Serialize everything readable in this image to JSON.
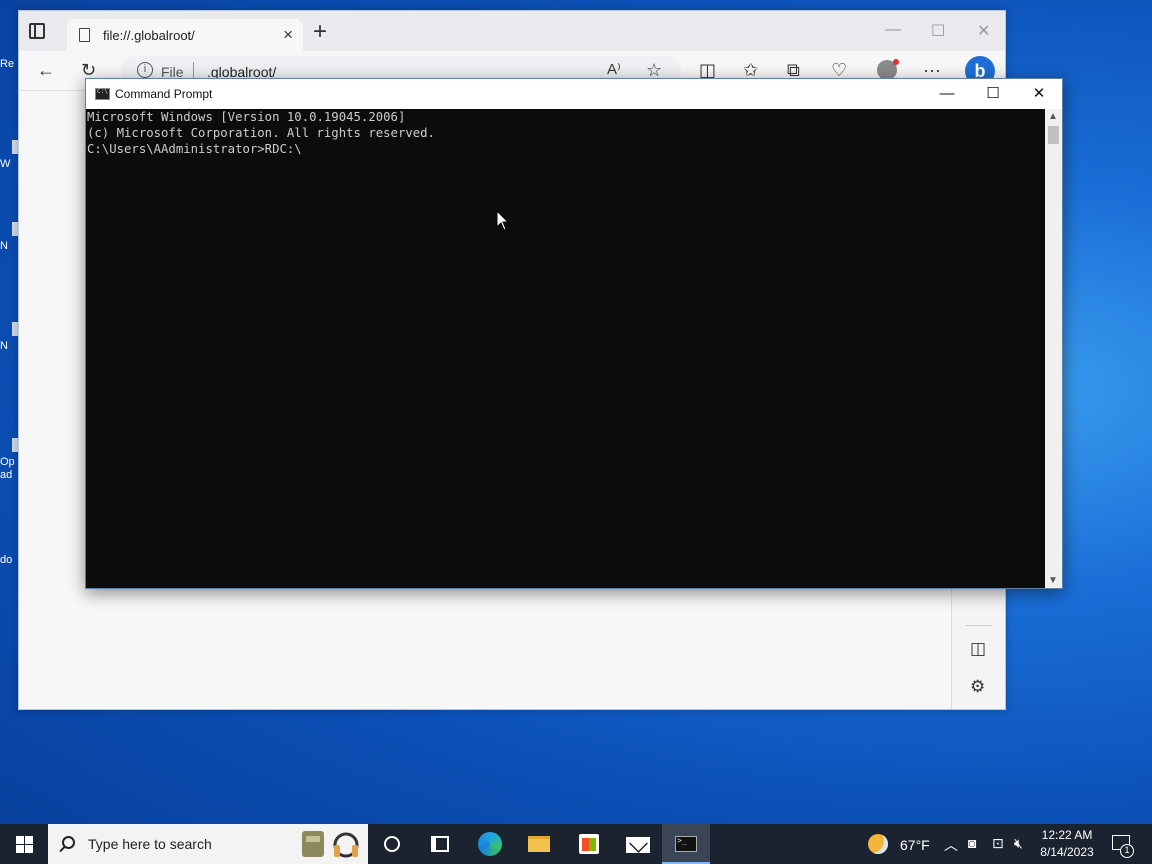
{
  "desktop": {
    "fragments": [
      "Re",
      "W",
      "N",
      "N",
      "Op",
      "ad",
      "do"
    ]
  },
  "browser": {
    "tab_title": "file://.globalroot/",
    "address_scheme": "File",
    "address_url": ".globalroot/",
    "controls": {
      "minimize": "—",
      "maximize": "☐",
      "close": "✕"
    }
  },
  "cmd_window": {
    "title": "Command Prompt",
    "lines": [
      "Microsoft Windows [Version 10.0.19045.2006]",
      "(c) Microsoft Corporation. All rights reserved.",
      "",
      "C:\\Users\\AAdministrator>RDC:\\"
    ]
  },
  "taskbar": {
    "search_placeholder": "Type here to search",
    "weather_temp": "67°F",
    "clock_time": "12:22 AM",
    "clock_date": "8/14/2023",
    "notification_count": "1"
  },
  "icons": {
    "back": "back-arrow-icon",
    "refresh": "refresh-icon",
    "read_aloud": "read-aloud-icon",
    "favorite": "star-icon",
    "split": "split-screen-icon",
    "favorites": "favorites-icon",
    "collections": "collections-icon",
    "performance": "heart-pulse-icon",
    "more": "more-icon"
  }
}
